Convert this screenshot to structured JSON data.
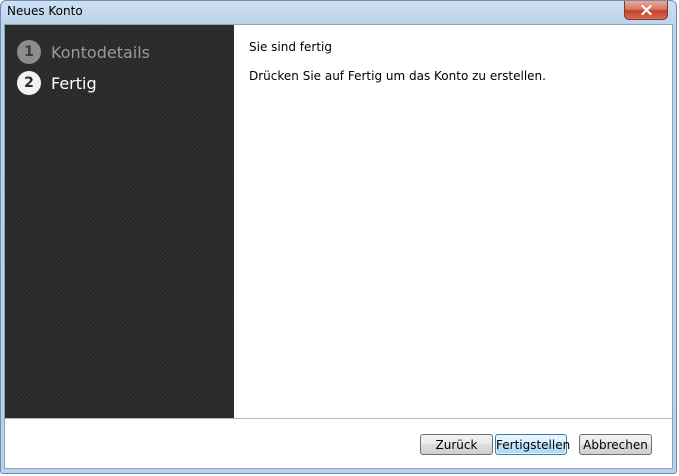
{
  "window": {
    "title": "Neues Konto"
  },
  "sidebar": {
    "steps": [
      {
        "number": "1",
        "label": "Kontodetails",
        "state": "done"
      },
      {
        "number": "2",
        "label": "Fertig",
        "state": "current"
      }
    ]
  },
  "content": {
    "heading": "Sie sind fertig",
    "text": "Drücken Sie auf Fertig um das Konto zu erstellen."
  },
  "footer": {
    "back_label": "Zurück",
    "finish_label": "Fertigstellen",
    "cancel_label": "Abbrechen"
  },
  "icons": {
    "close": "close-icon"
  },
  "colors": {
    "sidebar_bg": "#2b2b2b",
    "primary_button_border": "#3c7fb1",
    "close_button": "#c2412a"
  }
}
